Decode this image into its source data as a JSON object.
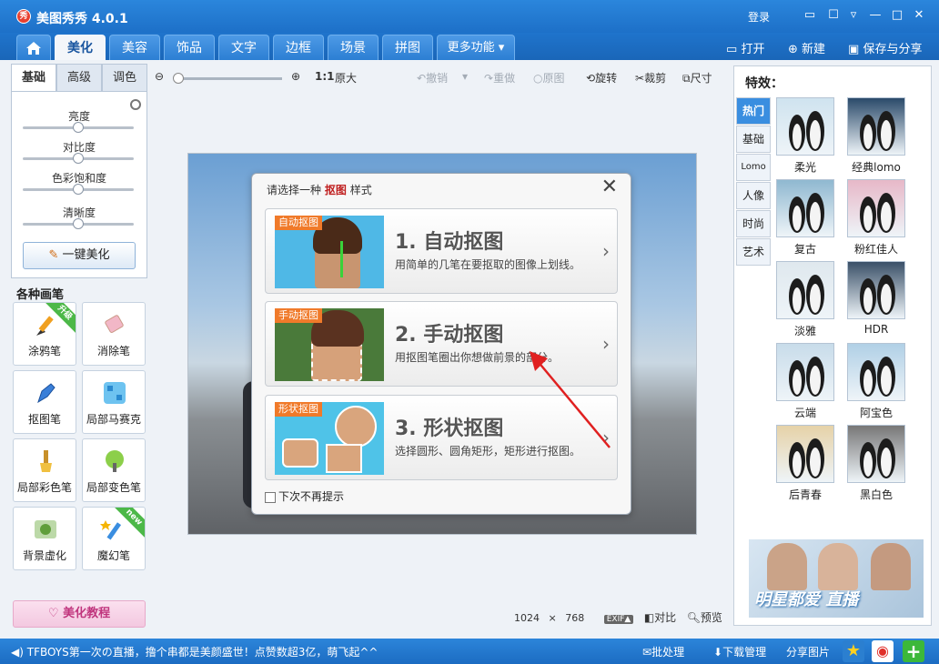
{
  "app": {
    "logo_text": "秀",
    "title": "美图秀秀 4.0.1"
  },
  "titlebar": {
    "login": "登录"
  },
  "tabs": [
    "美化",
    "美容",
    "饰品",
    "文字",
    "边框",
    "场景",
    "拼图",
    "更多功能 ▾"
  ],
  "toolbar_right": {
    "open": "打开",
    "new": "新建",
    "save_share": "保存与分享"
  },
  "left_tabs": [
    "基础",
    "高级",
    "调色"
  ],
  "sliders": [
    {
      "label": "亮度",
      "value": 0.5
    },
    {
      "label": "对比度",
      "value": 0.5
    },
    {
      "label": "色彩饱和度",
      "value": 0.5
    },
    {
      "label": "清晰度",
      "value": 0.5
    }
  ],
  "auto_beautify": "一键美化",
  "brushes_title": "各种画笔",
  "brushes": [
    {
      "label": "涂鸦笔",
      "badge": "升级"
    },
    {
      "label": "消除笔",
      "badge": ""
    },
    {
      "label": "抠图笔",
      "badge": ""
    },
    {
      "label": "局部马赛克",
      "badge": ""
    },
    {
      "label": "局部彩色笔",
      "badge": ""
    },
    {
      "label": "局部变色笔",
      "badge": ""
    },
    {
      "label": "背景虚化",
      "badge": ""
    },
    {
      "label": "魔幻笔",
      "badge": "new"
    }
  ],
  "tutorial": "美化教程",
  "canvas_toolbar": {
    "ratio": "1:1",
    "original_size": "原大",
    "undo": "撤销",
    "redo": "重做",
    "original": "原图",
    "rotate": "旋转",
    "crop": "裁剪",
    "size": "尺寸"
  },
  "dialog": {
    "title_prefix": "请选择一种",
    "title_highlight": "抠图",
    "title_suffix": "样式",
    "close": "✕",
    "options": [
      {
        "tag": "自动抠图",
        "title": "1. 自动抠图",
        "desc": "用简单的几笔在要抠取的图像上划线。"
      },
      {
        "tag": "手动抠图",
        "title": "2. 手动抠图",
        "desc": "用抠图笔圈出你想做前景的部分。"
      },
      {
        "tag": "形状抠图",
        "title": "3. 形状抠图",
        "desc": "选择圆形、圆角矩形，矩形进行抠图。"
      }
    ],
    "no_prompt": "下次不再提示"
  },
  "status": {
    "width": "1024",
    "x": "×",
    "height": "768",
    "exif": "EXIF▲",
    "compare": "对比",
    "preview": "预览"
  },
  "effects": {
    "title": "特效：",
    "categories": [
      "热门",
      "基础",
      "Lomo",
      "人像",
      "时尚",
      "艺术"
    ],
    "items": [
      "柔光",
      "经典lomo",
      "复古",
      "粉红佳人",
      "淡雅",
      "HDR",
      "云端",
      "阿宝色",
      "后青春",
      "黑白色"
    ],
    "ad_text": "明星都爱 直播"
  },
  "bottombar": {
    "news": "TFBOYS第一次の直播，撸个串都是美颜盛世！点赞数超3亿，萌飞起^^",
    "batch": "批处理",
    "download": "下载管理",
    "share": "分享图片"
  },
  "colors": {
    "accent": "#1f6fc6",
    "arrow": "#e02020",
    "orange_tag": "#f07a2a"
  }
}
